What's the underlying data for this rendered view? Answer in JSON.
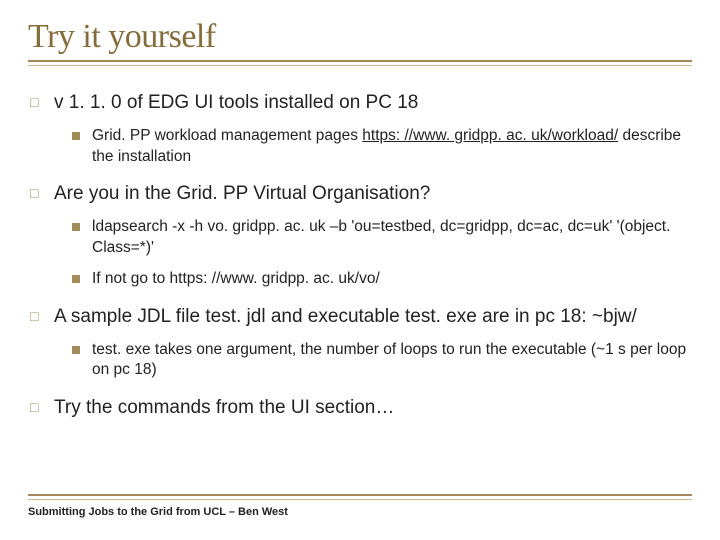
{
  "title": "Try it yourself",
  "items": [
    {
      "level": 1,
      "text": "v 1. 1. 0 of EDG UI tools installed on PC 18"
    },
    {
      "level": 2,
      "parts": [
        {
          "t": "Grid. PP workload management pages "
        },
        {
          "t": "https: //www. gridpp. ac. uk/workload/",
          "link": true
        },
        {
          "t": " describe the installation"
        }
      ]
    },
    {
      "level": 1,
      "text": "Are you in the Grid. PP Virtual Organisation?"
    },
    {
      "level": 2,
      "text": "ldapsearch -x -h vo. gridpp. ac. uk –b 'ou=testbed, dc=gridpp, dc=ac, dc=uk' '(object. Class=*)'"
    },
    {
      "level": 2,
      "text": "If not go to https: //www. gridpp. ac. uk/vo/"
    },
    {
      "level": 1,
      "text": "A sample JDL file test. jdl and executable test. exe are in pc 18: ~bjw/"
    },
    {
      "level": 2,
      "text": "test. exe takes one argument, the number of loops to run the executable (~1 s per loop on pc 18)"
    },
    {
      "level": 1,
      "text": "Try the commands from the UI section…"
    }
  ],
  "footer": "Submitting Jobs to the Grid from UCL – Ben West",
  "icons": {
    "square": "□"
  }
}
